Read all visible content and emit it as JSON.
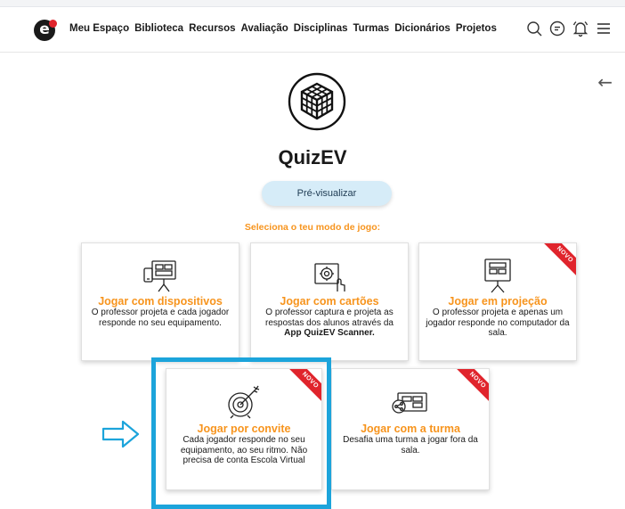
{
  "nav": {
    "items": [
      "Meu Espaço",
      "Biblioteca",
      "Recursos",
      "Avaliação",
      "Disciplinas",
      "Turmas",
      "Dicionários",
      "Projetos"
    ],
    "icons": [
      "search-icon",
      "chat-icon",
      "bell-icon",
      "menu-icon"
    ]
  },
  "logo": {
    "letter": "e"
  },
  "app": {
    "title": "QuizEV",
    "preview_label": "Pré-visualizar",
    "mode_prompt": "Seleciona o teu modo de jogo:"
  },
  "modes": [
    {
      "title": "Jogar com dispositivos",
      "desc": "O professor projeta e cada jogador responde no seu equipamento.",
      "desc_bold": "",
      "badge": ""
    },
    {
      "title": "Jogar com cartões",
      "desc": "O professor captura e projeta as respostas dos alunos através da",
      "desc_bold": "App QuizEV Scanner.",
      "badge": ""
    },
    {
      "title": "Jogar em projeção",
      "desc": "O professor projeta e apenas um jogador responde no computador da sala.",
      "desc_bold": "",
      "badge": "NOVO"
    },
    {
      "title": "Jogar por convite",
      "desc": "Cada jogador responde no seu equipamento, ao seu ritmo. Não precisa de conta Escola Virtual",
      "desc_bold": "",
      "badge": "NOVO"
    },
    {
      "title": "Jogar com a turma",
      "desc": "Desafia uma turma a jogar fora da sala.",
      "desc_bold": "",
      "badge": "NOVO"
    }
  ],
  "colors": {
    "accent": "#f7941d",
    "highlight": "#1ca4db",
    "badge": "#e0242c",
    "button": "#d6ecf8"
  }
}
